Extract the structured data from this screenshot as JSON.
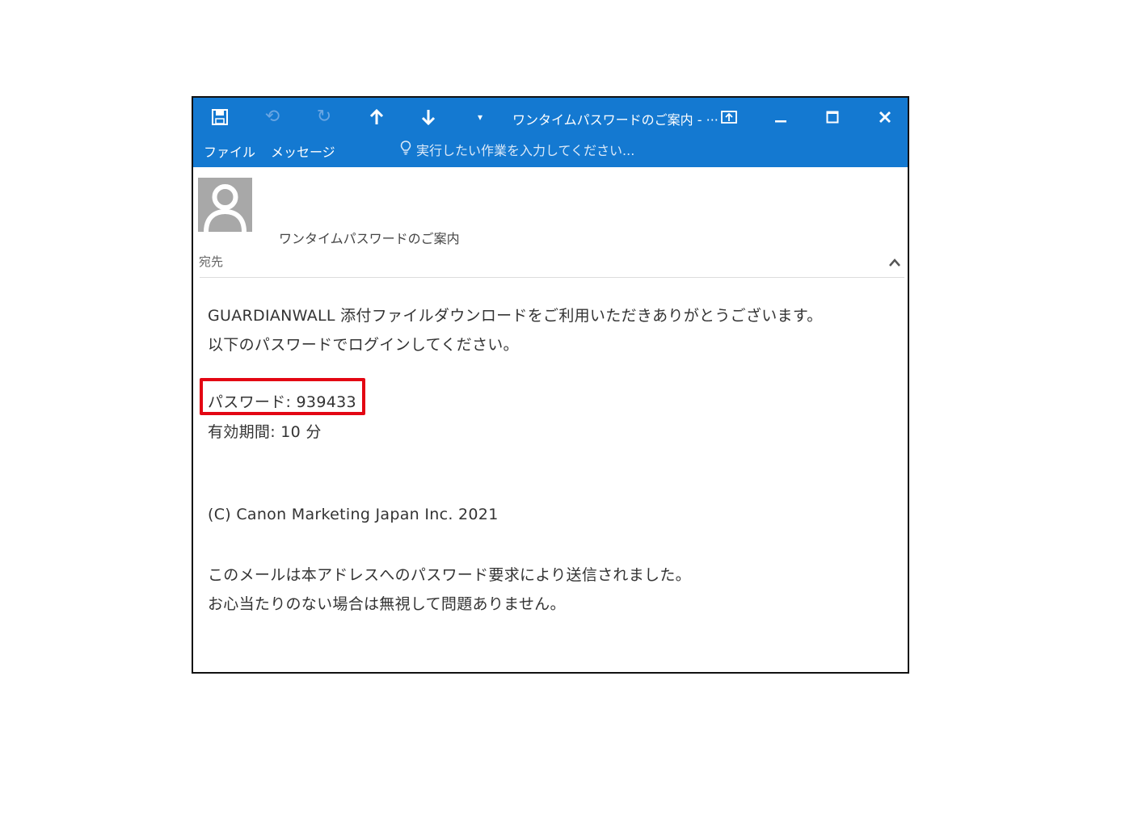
{
  "window": {
    "title": "ワンタイムパスワードのご案内 - ···",
    "menu": {
      "file": "ファイル",
      "message": "メッセージ"
    },
    "tell_me_placeholder": "実行したい作業を入力してください..."
  },
  "header": {
    "subject": "ワンタイムパスワードのご案内",
    "to_label": "宛先"
  },
  "body": {
    "line1": "GUARDIANWALL 添付ファイルダウンロードをご利用いただきありがとうございます。",
    "line2": "以下のパスワードでログインしてください。",
    "password": "パスワード: 939433",
    "validity": "有効期間: 10 分",
    "copyright": "(C) Canon Marketing Japan Inc. 2021",
    "notice1": "このメールは本アドレスへのパスワード要求により送信されました。",
    "notice2": "お心当たりのない場合は無視して問題ありません。"
  },
  "icons": [
    "save-icon",
    "undo-icon",
    "redo-icon",
    "previous-item-icon",
    "next-item-icon",
    "customize-toolbar-icon",
    "ribbon-display-options-icon",
    "minimize-icon",
    "maximize-icon",
    "close-icon",
    "lightbulb-icon",
    "contact-avatar",
    "collapse-header-icon"
  ],
  "colors": {
    "titlebar": "#1479d1",
    "highlight": "#e30613"
  }
}
